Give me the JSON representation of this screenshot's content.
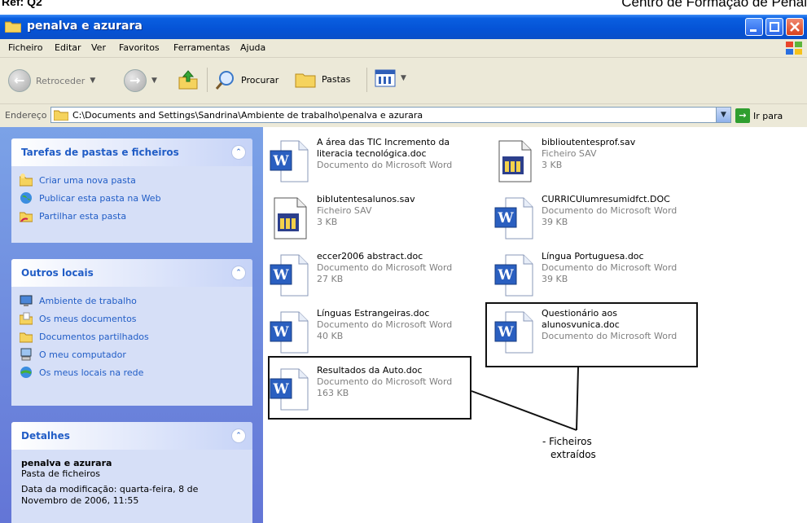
{
  "doc_header": {
    "left": "Ref: Q2",
    "right": "Centro de Formação de Penal"
  },
  "window": {
    "title": "penalva e azurara"
  },
  "menu": [
    "Ficheiro",
    "Editar",
    "Ver",
    "Favoritos",
    "Ferramentas",
    "Ajuda"
  ],
  "toolbar": {
    "back": "Retroceder",
    "search": "Procurar",
    "folders": "Pastas"
  },
  "address": {
    "label": "Endereço",
    "path": "C:\\Documents and Settings\\Sandrina\\Ambiente de trabalho\\penalva e azurara",
    "go": "Ir para"
  },
  "panels": {
    "tasks": {
      "title": "Tarefas de pastas e ficheiros",
      "items": [
        "Criar uma nova pasta",
        "Publicar esta pasta na Web",
        "Partilhar esta pasta"
      ]
    },
    "places": {
      "title": "Outros locais",
      "items": [
        "Ambiente de trabalho",
        "Os meus documentos",
        "Documentos partilhados",
        "O meu computador",
        "Os meus locais na rede"
      ]
    },
    "details": {
      "title": "Detalhes",
      "name": "penalva e azurara",
      "type": "Pasta de ficheiros",
      "modified": "Data da modificação: quarta-feira, 8 de Novembro de 2006, 11:55"
    }
  },
  "files": [
    {
      "name": "A área das TIC Incremento da literacia tecnológica.doc",
      "type": "Documento do Microsoft Word",
      "size": "",
      "icon": "word-doc"
    },
    {
      "name": "biblioutentesprof.sav",
      "type": "Ficheiro SAV",
      "size": "3 KB",
      "icon": "spss-sav"
    },
    {
      "name": "biblutentesalunos.sav",
      "type": "Ficheiro SAV",
      "size": "3 KB",
      "icon": "spss-sav"
    },
    {
      "name": "CURRICUlumresumidfct.DOC",
      "type": "Documento do Microsoft Word",
      "size": "39 KB",
      "icon": "word-doc"
    },
    {
      "name": "eccer2006 abstract.doc",
      "type": "Documento do Microsoft Word",
      "size": "27 KB",
      "icon": "word-doc"
    },
    {
      "name": "Língua Portuguesa.doc",
      "type": "Documento do Microsoft Word",
      "size": "39 KB",
      "icon": "word-doc"
    },
    {
      "name": "Línguas Estrangeiras.doc",
      "type": "Documento do Microsoft Word",
      "size": "40 KB",
      "icon": "word-doc"
    },
    {
      "name": "Questionário aos alunosvunica.doc",
      "type": "Documento do Microsoft Word",
      "size": "",
      "icon": "word-doc"
    },
    {
      "name": "Resultados da Auto.doc",
      "type": "Documento do Microsoft Word",
      "size": "163 KB",
      "icon": "word-doc"
    }
  ],
  "annotation": {
    "bullet": "-",
    "line1": "Ficheiros",
    "line2": "extraídos"
  }
}
